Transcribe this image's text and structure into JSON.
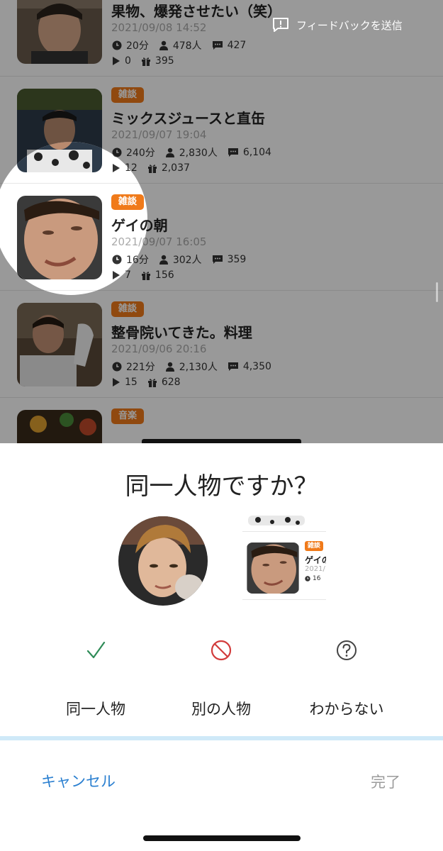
{
  "feedback_label": "フィードバックを送信",
  "feed": [
    {
      "category": "",
      "title": "果物、爆発させたい（笑）",
      "date": "2021/09/08 14:52",
      "duration": "20分",
      "viewers": "478人",
      "comments": "427",
      "plays": "0",
      "gifts": "395"
    },
    {
      "category": "雑談",
      "title": "ミックスジュースと直缶",
      "date": "2021/09/07 19:04",
      "duration": "240分",
      "viewers": "2,830人",
      "comments": "6,104",
      "plays": "12",
      "gifts": "2,037"
    },
    {
      "category": "雑談",
      "title": "ゲイの朝",
      "date": "2021/09/07 16:05",
      "duration": "16分",
      "viewers": "302人",
      "comments": "359",
      "plays": "7",
      "gifts": "156"
    },
    {
      "category": "雑談",
      "title": "整骨院いてきた。料理",
      "date": "2021/09/06 20:16",
      "duration": "221分",
      "viewers": "2,130人",
      "comments": "4,350",
      "plays": "15",
      "gifts": "628"
    },
    {
      "category": "音楽",
      "title": "",
      "date": "",
      "duration": "",
      "viewers": "",
      "comments": "",
      "plays": "",
      "gifts": ""
    }
  ],
  "sheet": {
    "question": "同一人物ですか？",
    "crop": {
      "category": "雑談",
      "title": "ゲイの",
      "date": "2021/",
      "duration": "16"
    },
    "options": [
      {
        "label": "同一人物",
        "icon": "checkmark-icon",
        "color": "#2e8b57"
      },
      {
        "label": "別の人物",
        "icon": "prohibited-icon",
        "color": "#d23c3c"
      },
      {
        "label": "わからない",
        "icon": "question-circle-icon",
        "color": "#444444"
      }
    ],
    "cancel_label": "キャンセル",
    "done_label": "完了"
  },
  "colors": {
    "category_badge": "#f07a1a",
    "accent_blue": "#2a7fd0",
    "divider": "#cfe9f8"
  }
}
